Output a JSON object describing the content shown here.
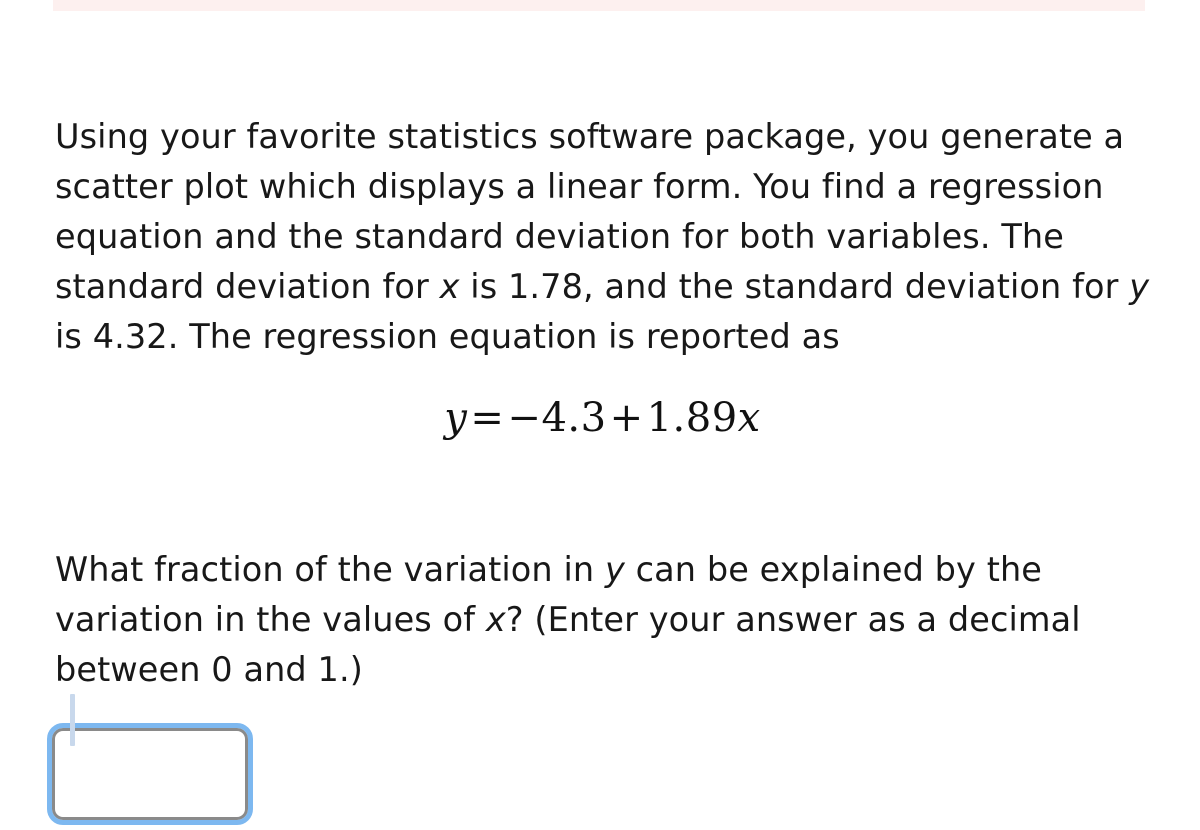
{
  "page": {
    "background_color": "#ffffff",
    "text_color": "#181818",
    "top_strip_color": "#fdf0ef"
  },
  "question": {
    "paragraph_1_parts": {
      "a": "Using your favorite statistics software package, you generate a scatter plot which displays a linear form. You find a regression equation and the standard deviation for both variables. The standard deviation for ",
      "var_x": "x",
      "b": " is 1.78, and the standard deviation for ",
      "var_y": "y",
      "c": " is 4.32. The regression equation is reported as"
    },
    "sd_x": "1.78",
    "sd_y": "4.32",
    "equation": {
      "lhs": "y",
      "equals": "=",
      "intercept_sign": "−",
      "intercept": "4.3",
      "plus": "+",
      "slope": "1.89",
      "rhs_var": "x",
      "plain": "y = −4.3 + 1.89x"
    },
    "paragraph_2_parts": {
      "a": "What fraction of the variation in ",
      "var_y": "y",
      "b": " can be explained by the variation in the values of ",
      "var_x": "x",
      "c": "? (Enter your answer as a decimal between 0 and 1.)"
    }
  },
  "answer_field": {
    "value": "",
    "placeholder": "",
    "focused": true,
    "focus_ring_color": "#7db8f0",
    "border_color": "#8a8a8a",
    "caret_color": "#c8d8ec"
  }
}
